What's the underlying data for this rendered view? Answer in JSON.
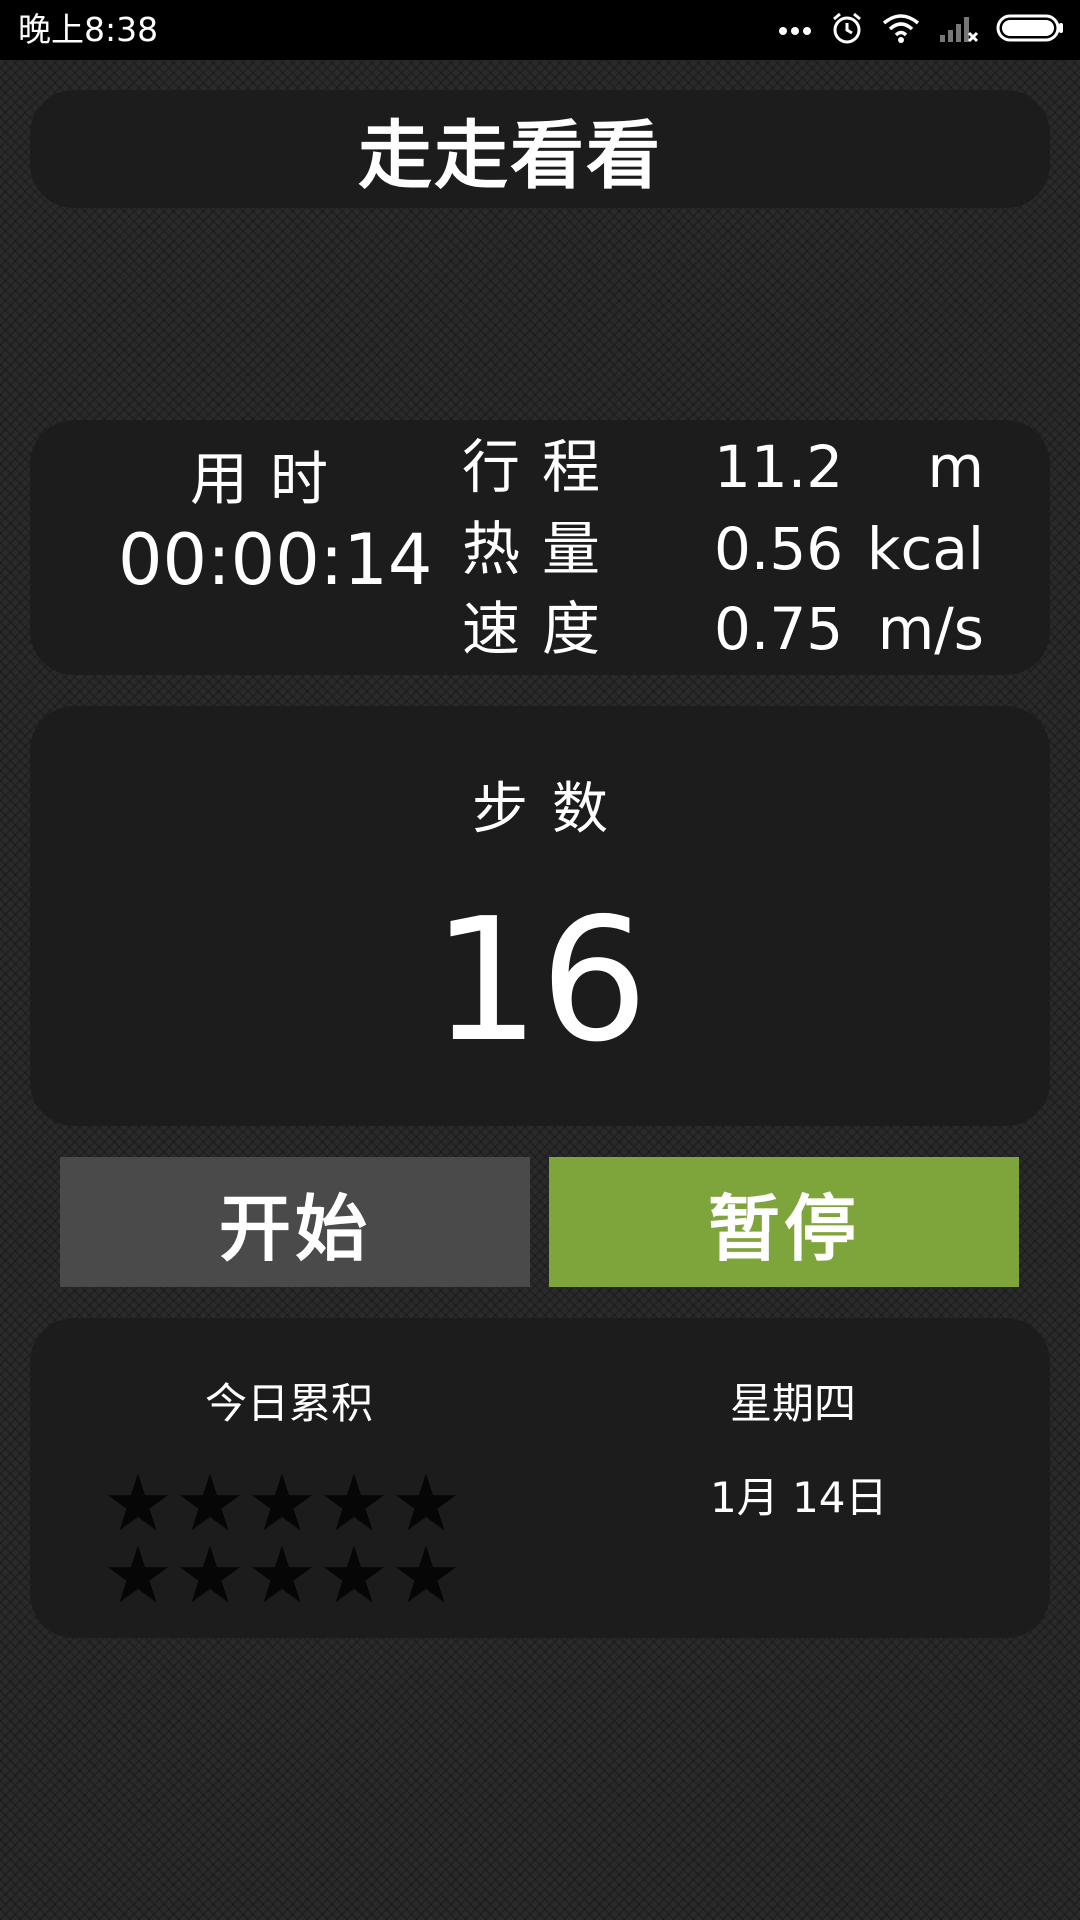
{
  "status_bar": {
    "time": "晚上8:38",
    "icons": [
      "more-dots-icon",
      "alarm-icon",
      "wifi-icon",
      "signal-no-sim-icon",
      "battery-icon"
    ]
  },
  "title": "走走看看",
  "stats": {
    "elapsed_label": "用时",
    "elapsed_value": "00:00:14",
    "distance_label": "行程",
    "distance_value": "11.2",
    "distance_unit": "m",
    "calories_label": "热量",
    "calories_value": "0.56",
    "calories_unit": "kcal",
    "speed_label": "速度",
    "speed_value": "0.75",
    "speed_unit": "m/s"
  },
  "steps": {
    "label": "步数",
    "value": "16"
  },
  "buttons": {
    "start": "开始",
    "pause": "暂停"
  },
  "today": {
    "label": "今日累积",
    "stars_filled": 0,
    "stars_total": 10,
    "star_glyph": "★",
    "weekday": "星期四",
    "date": "1月 14日"
  },
  "colors": {
    "pause_green": "#7ea43c",
    "start_gray": "#4a4a4a",
    "card_bg": "#1c1c1c"
  }
}
